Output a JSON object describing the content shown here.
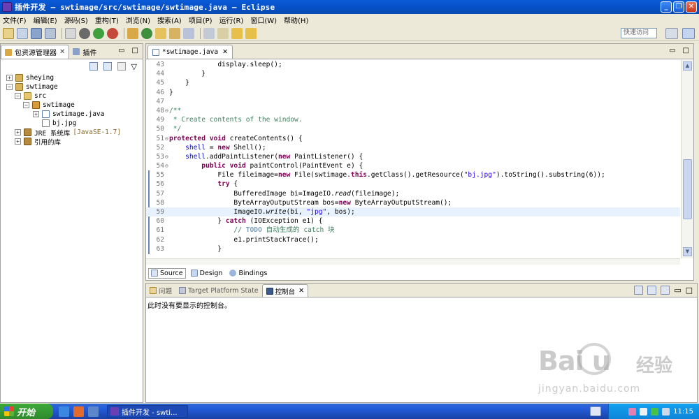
{
  "window": {
    "title": "插件开发 — swtimage/src/swtimage/swtimage.java — Eclipse",
    "min": "_",
    "max": "❐",
    "close": "✕"
  },
  "menu": [
    "文件(F)",
    "编辑(E)",
    "源码(S)",
    "重构(T)",
    "浏览(N)",
    "搜索(A)",
    "项目(P)",
    "运行(R)",
    "窗口(W)",
    "帮助(H)"
  ],
  "quick_access": {
    "placeholder": "快速访问"
  },
  "left_panel": {
    "tabs": [
      {
        "label": "包资源管理器"
      },
      {
        "label": "插件"
      }
    ],
    "close": "✕",
    "min": "▭",
    "max": "□",
    "menu": "▽",
    "tree": [
      {
        "toggle": "+",
        "label": "sheying",
        "suffix": ""
      },
      {
        "toggle": "−",
        "label": "swtimage",
        "suffix": ""
      },
      {
        "toggle": "−",
        "label": "src",
        "suffix": ""
      },
      {
        "toggle": "−",
        "label": "swtimage",
        "suffix": ""
      },
      {
        "toggle": "+",
        "label": "swtimage.java",
        "suffix": ""
      },
      {
        "toggle": "",
        "label": "bj.jpg",
        "suffix": ""
      },
      {
        "toggle": "+",
        "label": "JRE 系统库",
        "suffix": "[JavaSE-1.7]"
      },
      {
        "toggle": "+",
        "label": "引用的库",
        "suffix": ""
      }
    ]
  },
  "editor": {
    "tab": "*swtimage.java",
    "close": "✕",
    "bottom_tabs": [
      "Source",
      "Design",
      "Bindings"
    ],
    "lines": [
      {
        "n": "43",
        "fold": "",
        "indent": "            ",
        "t": [
          [
            "display.sleep();",
            ""
          ]
        ]
      },
      {
        "n": "44",
        "fold": "",
        "indent": "        ",
        "t": [
          [
            "}",
            ""
          ]
        ]
      },
      {
        "n": "45",
        "fold": "",
        "indent": "    ",
        "t": [
          [
            "}",
            ""
          ]
        ]
      },
      {
        "n": "46",
        "fold": "",
        "indent": "",
        "t": [
          [
            "}",
            ""
          ]
        ]
      },
      {
        "n": "47",
        "fold": "",
        "indent": "",
        "t": []
      },
      {
        "n": "48",
        "fold": "⊖",
        "indent": "",
        "t": [
          [
            "/**",
            "cm"
          ]
        ]
      },
      {
        "n": "49",
        "fold": "",
        "indent": " ",
        "t": [
          [
            "* Create contents of the window.",
            "cm"
          ]
        ]
      },
      {
        "n": "50",
        "fold": "",
        "indent": " ",
        "t": [
          [
            "*/",
            "cm"
          ]
        ]
      },
      {
        "n": "51",
        "fold": "⊖",
        "indent": "",
        "t": [
          [
            "protected",
            "kw"
          ],
          [
            " ",
            ""
          ],
          [
            "void",
            "kw"
          ],
          [
            " createContents() {",
            ""
          ]
        ]
      },
      {
        "n": "52",
        "fold": "",
        "indent": "    ",
        "t": [
          [
            "shell",
            "fld"
          ],
          [
            " = ",
            ""
          ],
          [
            "new",
            "kw"
          ],
          [
            " Shell();",
            ""
          ]
        ]
      },
      {
        "n": "53",
        "fold": "⊖",
        "indent": "    ",
        "t": [
          [
            "shell",
            "fld"
          ],
          [
            ".addPaintListener(",
            ""
          ],
          [
            "new",
            "kw"
          ],
          [
            " PaintListener() {",
            ""
          ]
        ]
      },
      {
        "n": "54",
        "fold": "⊖",
        "indent": "        ",
        "t": [
          [
            "public",
            "kw"
          ],
          [
            " ",
            ""
          ],
          [
            "void",
            "kw"
          ],
          [
            " paintControl(PaintEvent e) {",
            ""
          ]
        ]
      },
      {
        "n": "55",
        "fold": "",
        "indent": "            ",
        "t": [
          [
            "File fileimage=",
            ""
          ],
          [
            "new",
            "kw"
          ],
          [
            " File(swtimage.",
            ""
          ],
          [
            "this",
            "kw"
          ],
          [
            ".getClass().getResource(",
            ""
          ],
          [
            "\"bj.jpg\"",
            "st"
          ],
          [
            ").toString().substring(6));",
            ""
          ]
        ]
      },
      {
        "n": "56",
        "fold": "",
        "indent": "            ",
        "t": [
          [
            "try",
            "kw"
          ],
          [
            " {",
            ""
          ]
        ]
      },
      {
        "n": "57",
        "fold": "",
        "indent": "                ",
        "t": [
          [
            "BufferedImage bi=ImageIO.",
            ""
          ],
          [
            "read",
            "it"
          ],
          [
            "(fileimage);",
            ""
          ]
        ]
      },
      {
        "n": "58",
        "fold": "",
        "indent": "                ",
        "t": [
          [
            "ByteArrayOutputStream bos=",
            ""
          ],
          [
            "new",
            "kw"
          ],
          [
            " ByteArrayOutputStream();",
            ""
          ]
        ]
      },
      {
        "n": "59",
        "fold": "",
        "indent": "                ",
        "t": [
          [
            "ImageIO.",
            ""
          ],
          [
            "write",
            "it"
          ],
          [
            "(bi, ",
            ""
          ],
          [
            "\"jpg\"",
            "st"
          ],
          [
            ", bos);",
            ""
          ]
        ],
        "hl": true
      },
      {
        "n": "60",
        "fold": "",
        "indent": "            ",
        "t": [
          [
            "}",
            ""
          ],
          [
            " catch",
            "kw"
          ],
          [
            " (IOException e1) {",
            ""
          ]
        ]
      },
      {
        "n": "61",
        "fold": "",
        "indent": "                ",
        "t": [
          [
            "// ",
            "cm"
          ],
          [
            "TODO",
            "todo"
          ],
          [
            " 自动生成的 catch 块",
            "cm"
          ]
        ]
      },
      {
        "n": "62",
        "fold": "",
        "indent": "                ",
        "t": [
          [
            "e1.printStackTrace();",
            ""
          ]
        ]
      },
      {
        "n": "63",
        "fold": "",
        "indent": "            ",
        "t": [
          [
            "}",
            ""
          ]
        ]
      }
    ]
  },
  "console_panel": {
    "tabs": [
      "问题",
      "Target Platform State",
      "控制台"
    ],
    "message": "此时没有要显示的控制台。"
  },
  "watermark": {
    "logo": "Bai  u",
    "cn": "经验",
    "url": "jingyan.baidu.com"
  },
  "taskbar": {
    "start": "开始",
    "task": "插件开发 - swti...",
    "clock": "11:15"
  }
}
